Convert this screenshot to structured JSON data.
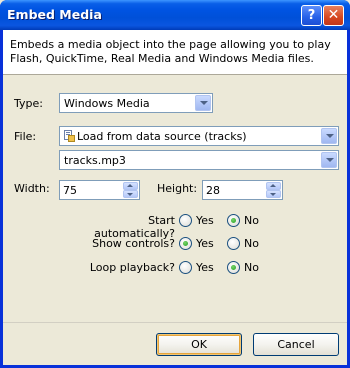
{
  "window": {
    "title": "Embed Media",
    "help_glyph": "?",
    "close_glyph": "✕"
  },
  "description": "Embeds a media object into the page allowing you to play Flash, QuickTime, Real Media and Windows Media files.",
  "type": {
    "label": "Type:",
    "value": "Windows Media"
  },
  "file": {
    "label": "File:",
    "source_value": "Load from data source (tracks)",
    "file_value": "tracks.mp3"
  },
  "width": {
    "label": "Width:",
    "value": "75"
  },
  "height": {
    "label": "Height:",
    "value": "28"
  },
  "options": {
    "start": {
      "label": "Start automatically?",
      "yes": "Yes",
      "no": "No",
      "selected": "No"
    },
    "controls": {
      "label": "Show controls?",
      "yes": "Yes",
      "no": "No",
      "selected": "Yes"
    },
    "loop": {
      "label": "Loop playback?",
      "yes": "Yes",
      "no": "No",
      "selected": "No"
    }
  },
  "buttons": {
    "ok": "OK",
    "cancel": "Cancel"
  },
  "colors": {
    "title_bar": "#0054e3",
    "dialog_bg": "#ece9d8",
    "field_border": "#7f9db9",
    "radio_dot": "#21a121"
  }
}
